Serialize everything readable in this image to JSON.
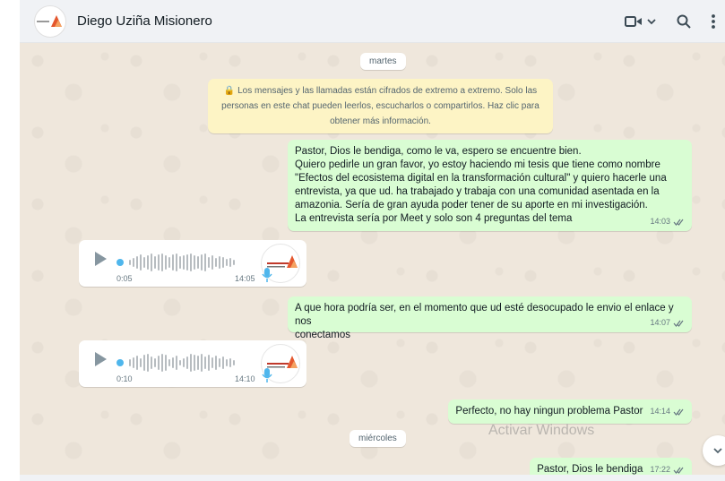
{
  "header": {
    "contact_name": "Diego Uziña Misionero",
    "icons": [
      "video-call-icon",
      "chevron-down-icon",
      "search-icon",
      "menu-icon"
    ]
  },
  "chat": {
    "day_labels": [
      "martes",
      "miércoles"
    ],
    "encryption_notice": [
      "🔒 Los mensajes y las llamadas están cifrados de extremo a extremo. Solo las",
      "personas en este chat pueden leerlos, escucharlos o compartirlos. Haz clic para",
      "obtener más información."
    ],
    "messages": {
      "m1": {
        "lines": [
          "Pastor, Dios le bendiga, como le va, espero se encuentre bien.",
          "Quiero pedirle un gran favor, yo estoy haciendo mi tesis que tiene como nombre",
          "\"Efectos del ecosistema digital en la transformación cultural\" y quiero hacerle una",
          "entrevista, ya que ud. ha trabajado y trabaja con una comunidad asentada en la",
          "amazonia. Sería de gran ayuda poder tener de su aporte en mi investigación.",
          "La entrevista sería por Meet y solo son 4 preguntas del tema"
        ],
        "time": "14:03"
      },
      "a1": {
        "duration": "0:05",
        "time": "14:05"
      },
      "m2": {
        "lines": [
          "A que hora podría ser, en el momento que ud esté desocupado le envio el enlace y nos",
          "conectamos"
        ],
        "time": "14:07"
      },
      "a2": {
        "duration": "0:10",
        "time": "14:10"
      },
      "m3": {
        "text": "Perfecto, no hay ningun problema Pastor",
        "time": "14:14"
      },
      "m4": {
        "text": "Pastor, Dios le bendiga",
        "time": "17:22"
      }
    }
  },
  "watermark": "Activar Windows",
  "colors": {
    "outgoing_bubble": "#d9fdd3",
    "incoming_bubble": "#ffffff",
    "chat_background": "#efe7dc",
    "read_ticks": "#667781",
    "audio_dot": "#4fb6ec"
  }
}
